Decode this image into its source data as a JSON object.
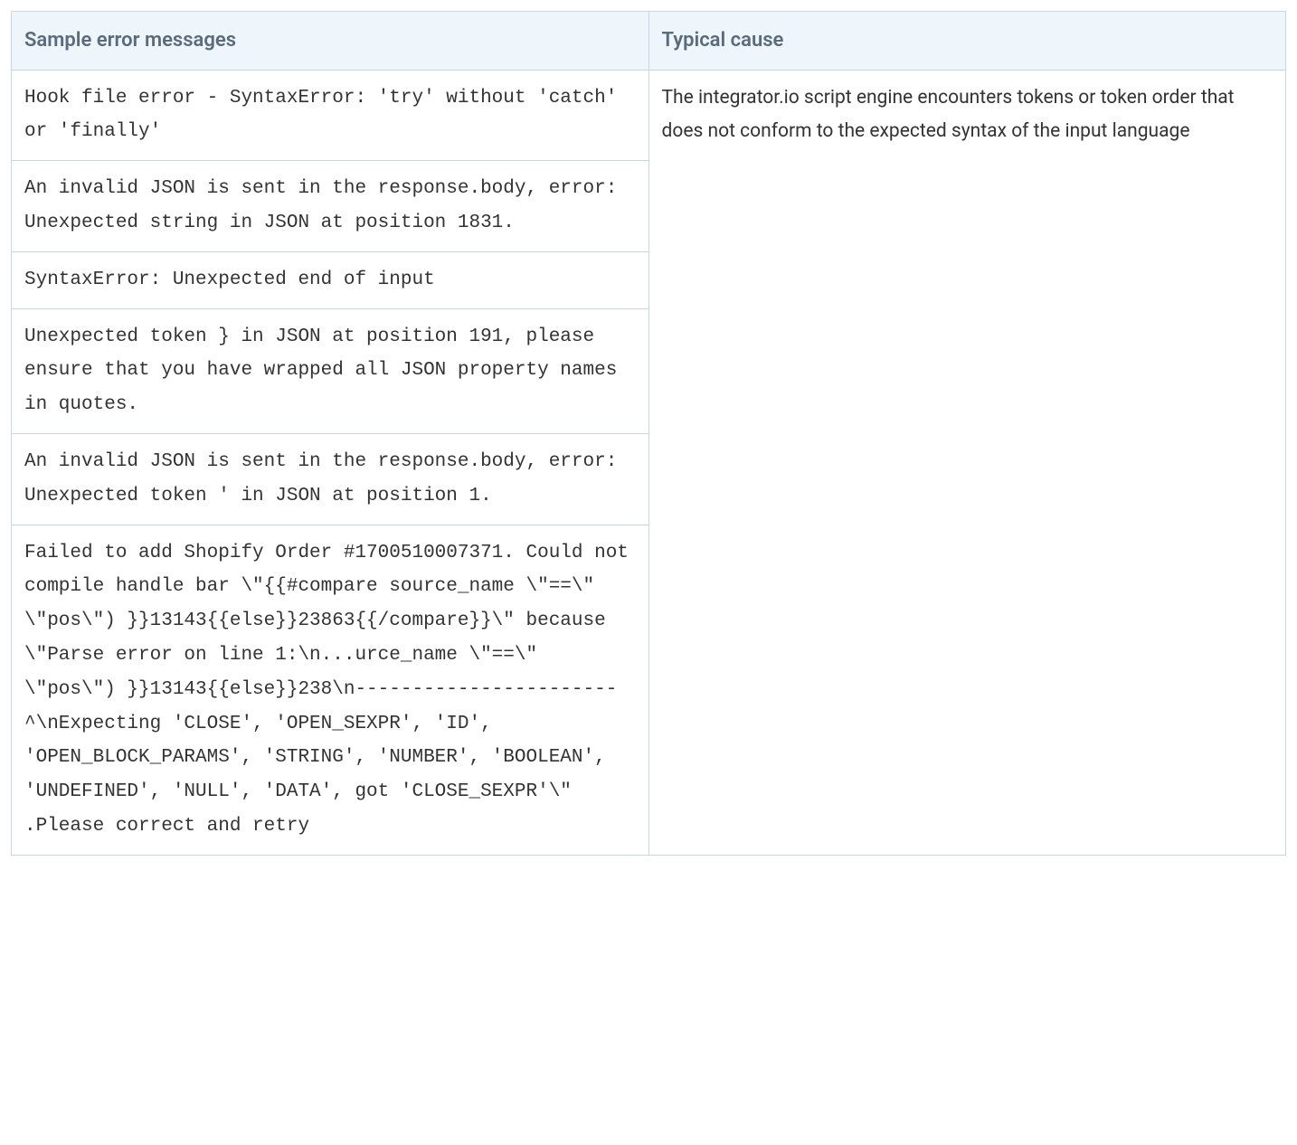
{
  "table": {
    "headers": {
      "sample": "Sample error messages",
      "cause": "Typical cause"
    },
    "cause": "The integrator.io script engine encounters tokens or token order that does not conform to the expected syntax of the input language",
    "samples": [
      "Hook file error - SyntaxError: 'try' without 'catch' or 'finally'",
      "An invalid JSON is sent in the response.body, error: Unexpected string in JSON at position 1831.",
      "SyntaxError: Unexpected end of input",
      "Unexpected token } in JSON at position 191, please ensure that you have wrapped all JSON property names in quotes.",
      "An invalid JSON is sent in the response.body, error: Unexpected token ' in JSON at position 1.",
      "Failed to add Shopify Order #1700510007371. Could not compile handle bar \\\"{{#compare source_name \\\"==\\\" \\\"pos\\\") }}13143{{else}}23863{{/compare}}\\\" because \\\"Parse error on line 1:\\n...urce_name \\\"==\\\" \\\"pos\\\") }}13143{{else}}238\\n-----------------------^\\nExpecting 'CLOSE', 'OPEN_SEXPR', 'ID', 'OPEN_BLOCK_PARAMS', 'STRING', 'NUMBER', 'BOOLEAN', 'UNDEFINED', 'NULL', 'DATA', got 'CLOSE_SEXPR'\\\" .Please correct and retry"
    ]
  }
}
